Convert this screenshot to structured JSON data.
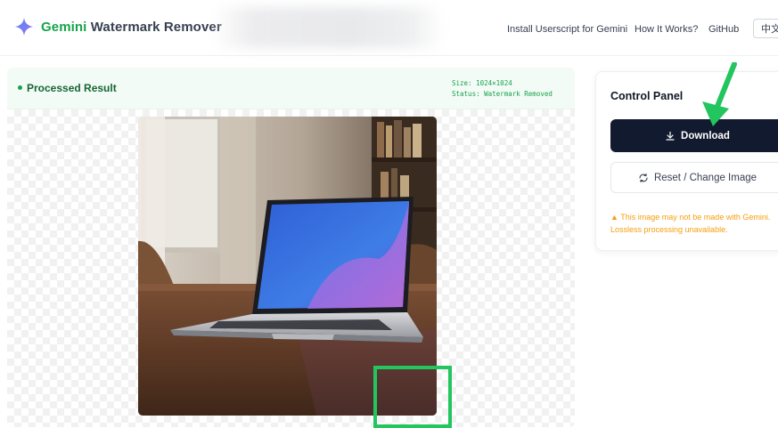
{
  "header": {
    "brand_accent": "Gemini",
    "brand_rest": " Watermark Remover",
    "nav": [
      "Install Userscript for Gemini",
      "How It Works?",
      "GitHub"
    ],
    "lang": "中文"
  },
  "result": {
    "title": "Processed Result",
    "size_text": "Size: 1024×1024",
    "status_text": "Status: Watermark Removed"
  },
  "control_panel": {
    "title": "Control Panel",
    "download_label": "Download",
    "reset_label": "Reset / Change Image",
    "warning_text": "This image may not be made with Gemini. Lossless processing unavailable."
  },
  "colors": {
    "accent": "#16a34a",
    "download_bg": "#111a2e",
    "warning": "#f59e0b",
    "annotation": "#22c55e"
  },
  "icons": [
    "sparkle-icon",
    "download-icon",
    "refresh-icon",
    "warning-icon"
  ]
}
